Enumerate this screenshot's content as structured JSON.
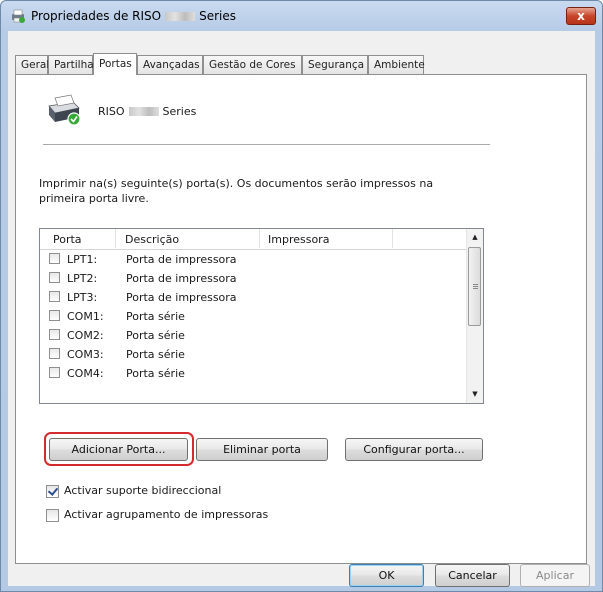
{
  "window": {
    "title_prefix": "Propriedades de RISO",
    "title_suffix": "Series",
    "close_label": "x"
  },
  "tabs": [
    "Geral",
    "Partilha",
    "Portas",
    "Avançadas",
    "Gestão de Cores",
    "Segurança",
    "Ambiente"
  ],
  "active_tab": "Portas",
  "printer": {
    "name_prefix": "RISO",
    "name_suffix": "Series"
  },
  "description": "Imprimir na(s) seguinte(s) porta(s). Os documentos serão impressos na primeira porta livre.",
  "port_list": {
    "columns": [
      "Porta",
      "Descrição",
      "Impressora"
    ],
    "rows": [
      {
        "port": "LPT1:",
        "description": "Porta de impressora",
        "checked": false
      },
      {
        "port": "LPT2:",
        "description": "Porta de impressora",
        "checked": false
      },
      {
        "port": "LPT3:",
        "description": "Porta de impressora",
        "checked": false
      },
      {
        "port": "COM1:",
        "description": "Porta série",
        "checked": false
      },
      {
        "port": "COM2:",
        "description": "Porta série",
        "checked": false
      },
      {
        "port": "COM3:",
        "description": "Porta série",
        "checked": false
      },
      {
        "port": "COM4:",
        "description": "Porta série",
        "checked": false
      }
    ]
  },
  "buttons": {
    "add_port": "Adicionar Porta...",
    "delete_port": "Eliminar porta",
    "configure_port": "Configurar porta...",
    "ok": "OK",
    "cancel": "Cancelar",
    "apply": "Aplicar"
  },
  "options": {
    "bidirectional": {
      "label": "Activar suporte bidireccional",
      "checked": true
    },
    "pooling": {
      "label": "Activar agrupamento de impressoras",
      "checked": false
    }
  },
  "colors": {
    "highlight": "#d42c2c",
    "titlebar": "#b6cbe6",
    "close_button": "#c8452c"
  }
}
